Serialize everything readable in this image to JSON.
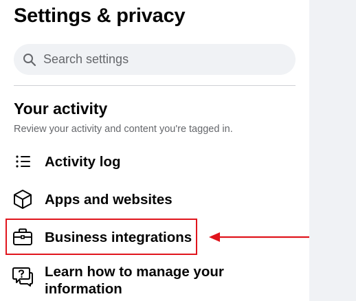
{
  "page": {
    "title": "Settings & privacy"
  },
  "search": {
    "placeholder": "Search settings",
    "value": ""
  },
  "section": {
    "title": "Your activity",
    "description": "Review your activity and content you're tagged in."
  },
  "items": [
    {
      "label": "Activity log",
      "icon": "list-icon"
    },
    {
      "label": "Apps and websites",
      "icon": "cube-icon"
    },
    {
      "label": "Business integrations",
      "icon": "briefcase-icon"
    },
    {
      "label": "Learn how to manage your information",
      "icon": "question-chat-icon"
    }
  ],
  "annotation": {
    "highlight_color": "#e0141c",
    "target": "Business integrations"
  }
}
